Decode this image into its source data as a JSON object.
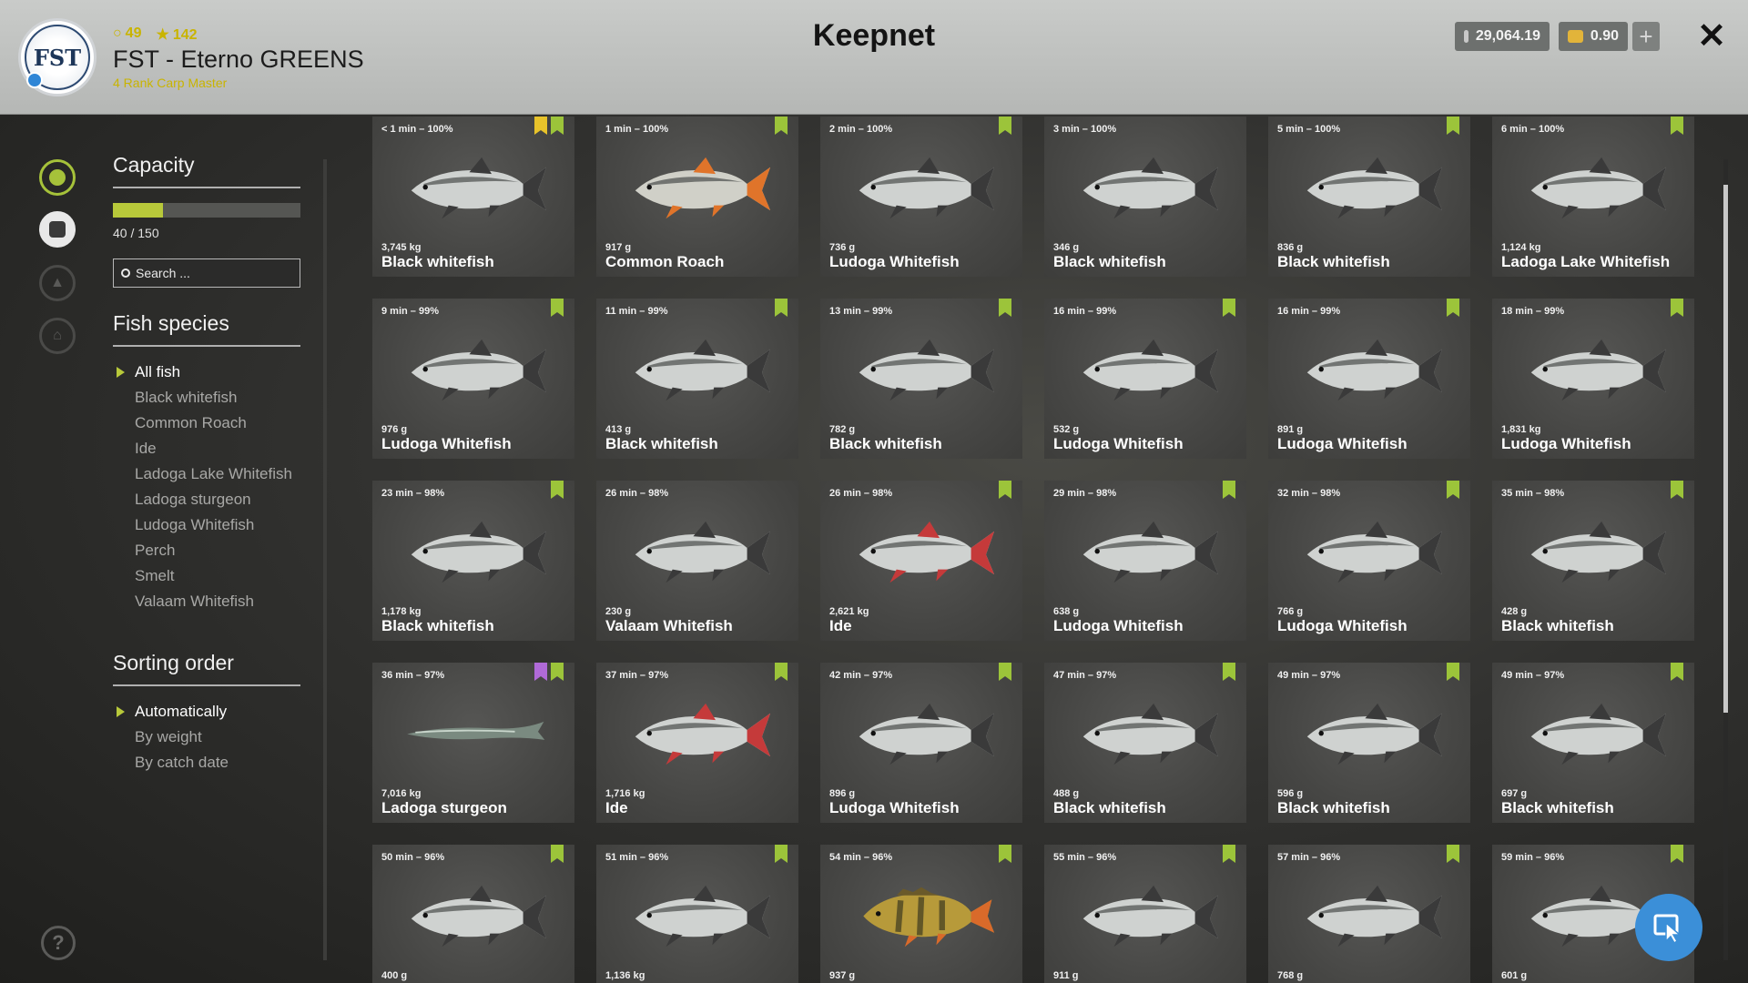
{
  "header": {
    "title": "Keepnet",
    "player": {
      "level": "49",
      "stars": "142",
      "club_name": "FST - Eterno GREENS",
      "rank_title": "4 Rank Carp Master",
      "logo_text": "FST"
    },
    "currency": {
      "silver": "29,064.19",
      "gold": "0.90"
    },
    "plus_label": "+",
    "close_label": "✕"
  },
  "sidebar": {
    "capacity": {
      "title": "Capacity",
      "used": 40,
      "max": 150,
      "text": "40 / 150"
    },
    "search_placeholder": "Search ...",
    "species": {
      "title": "Fish species",
      "items": [
        "All fish",
        "Black whitefish",
        "Common Roach",
        "Ide",
        "Ladoga Lake Whitefish",
        "Ladoga sturgeon",
        "Ludoga Whitefish",
        "Perch",
        "Smelt",
        "Valaam Whitefish"
      ],
      "active_index": 0
    },
    "sorting": {
      "title": "Sorting order",
      "items": [
        "Automatically",
        "By weight",
        "By catch date"
      ],
      "active_index": 0
    },
    "help_label": "?"
  },
  "fish": [
    {
      "time": "< 1 min – 100%",
      "weight": "3,745 kg",
      "name": "Black whitefish",
      "kind": "whitefish",
      "marks": [
        "green",
        "yellow"
      ]
    },
    {
      "time": "1 min – 100%",
      "weight": "917 g",
      "name": "Common Roach",
      "kind": "roach",
      "marks": [
        "green"
      ]
    },
    {
      "time": "2 min – 100%",
      "weight": "736 g",
      "name": "Ludoga Whitefish",
      "kind": "whitefish",
      "marks": [
        "green"
      ]
    },
    {
      "time": "3 min – 100%",
      "weight": "346 g",
      "name": "Black whitefish",
      "kind": "whitefish",
      "marks": []
    },
    {
      "time": "5 min – 100%",
      "weight": "836 g",
      "name": "Black whitefish",
      "kind": "whitefish",
      "marks": [
        "green"
      ]
    },
    {
      "time": "6 min – 100%",
      "weight": "1,124 kg",
      "name": "Ladoga Lake Whitefish",
      "kind": "whitefish",
      "marks": [
        "green"
      ]
    },
    {
      "time": "9 min – 99%",
      "weight": "976 g",
      "name": "Ludoga Whitefish",
      "kind": "whitefish",
      "marks": [
        "green"
      ]
    },
    {
      "time": "11 min – 99%",
      "weight": "413 g",
      "name": "Black whitefish",
      "kind": "whitefish",
      "marks": [
        "green"
      ]
    },
    {
      "time": "13 min – 99%",
      "weight": "782 g",
      "name": "Black whitefish",
      "kind": "whitefish",
      "marks": [
        "green"
      ]
    },
    {
      "time": "16 min – 99%",
      "weight": "532 g",
      "name": "Ludoga Whitefish",
      "kind": "whitefish",
      "marks": [
        "green"
      ]
    },
    {
      "time": "16 min – 99%",
      "weight": "891 g",
      "name": "Ludoga Whitefish",
      "kind": "whitefish",
      "marks": [
        "green"
      ]
    },
    {
      "time": "18 min – 99%",
      "weight": "1,831 kg",
      "name": "Ludoga Whitefish",
      "kind": "whitefish",
      "marks": [
        "green"
      ]
    },
    {
      "time": "23 min – 98%",
      "weight": "1,178 kg",
      "name": "Black whitefish",
      "kind": "whitefish",
      "marks": [
        "green"
      ]
    },
    {
      "time": "26 min – 98%",
      "weight": "230 g",
      "name": "Valaam Whitefish",
      "kind": "whitefish",
      "marks": []
    },
    {
      "time": "26 min – 98%",
      "weight": "2,621 kg",
      "name": "Ide",
      "kind": "ide",
      "marks": [
        "green"
      ]
    },
    {
      "time": "29 min – 98%",
      "weight": "638 g",
      "name": "Ludoga Whitefish",
      "kind": "whitefish",
      "marks": [
        "green"
      ]
    },
    {
      "time": "32 min – 98%",
      "weight": "766 g",
      "name": "Ludoga Whitefish",
      "kind": "whitefish",
      "marks": [
        "green"
      ]
    },
    {
      "time": "35 min – 98%",
      "weight": "428 g",
      "name": "Black whitefish",
      "kind": "whitefish",
      "marks": [
        "green"
      ]
    },
    {
      "time": "36 min – 97%",
      "weight": "7,016 kg",
      "name": "Ladoga sturgeon",
      "kind": "sturgeon",
      "marks": [
        "green",
        "purple"
      ]
    },
    {
      "time": "37 min – 97%",
      "weight": "1,716 kg",
      "name": "Ide",
      "kind": "ide",
      "marks": [
        "green"
      ]
    },
    {
      "time": "42 min – 97%",
      "weight": "896 g",
      "name": "Ludoga Whitefish",
      "kind": "whitefish",
      "marks": [
        "green"
      ]
    },
    {
      "time": "47 min – 97%",
      "weight": "488 g",
      "name": "Black whitefish",
      "kind": "whitefish",
      "marks": [
        "green"
      ]
    },
    {
      "time": "49 min – 97%",
      "weight": "596 g",
      "name": "Black whitefish",
      "kind": "whitefish",
      "marks": [
        "green"
      ]
    },
    {
      "time": "49 min – 97%",
      "weight": "697 g",
      "name": "Black whitefish",
      "kind": "whitefish",
      "marks": [
        "green"
      ]
    },
    {
      "time": "50 min – 96%",
      "weight": "400 g",
      "name": "",
      "kind": "whitefish",
      "marks": [
        "green"
      ]
    },
    {
      "time": "51 min – 96%",
      "weight": "1,136 kg",
      "name": "",
      "kind": "whitefish",
      "marks": [
        "green"
      ]
    },
    {
      "time": "54 min – 96%",
      "weight": "937 g",
      "name": "",
      "kind": "perch",
      "marks": [
        "green"
      ]
    },
    {
      "time": "55 min – 96%",
      "weight": "911 g",
      "name": "",
      "kind": "whitefish",
      "marks": [
        "green"
      ]
    },
    {
      "time": "57 min – 96%",
      "weight": "768 g",
      "name": "",
      "kind": "whitefish",
      "marks": [
        "green"
      ]
    },
    {
      "time": "59 min – 96%",
      "weight": "601 g",
      "name": "",
      "kind": "whitefish",
      "marks": [
        "green"
      ]
    }
  ],
  "colors": {
    "accent": "#b8c93a",
    "bookmark_green": "#9cc43a",
    "bookmark_yellow": "#e8c32a",
    "bookmark_purple": "#b06ad8",
    "cursor_button": "#3b8fd8"
  }
}
